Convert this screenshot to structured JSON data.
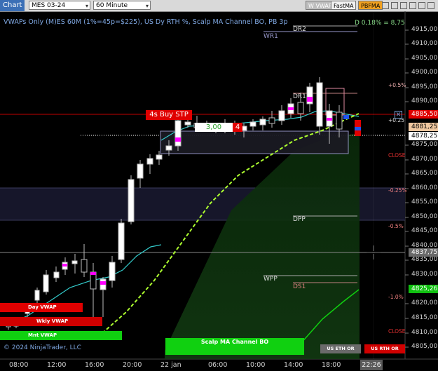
{
  "toolbar": {
    "chart_tab": "Chart",
    "instrument": "MES 03-24",
    "interval": "60 Minute",
    "buttons": [
      "W VWAP",
      "FastMA",
      "PBFMA"
    ]
  },
  "chart": {
    "title": "VWAPs Only (M)ES 60M  (1%=45p=$225), US Dy RTH %, Scalp MA Channel BO, PB 3p",
    "copyright": "© 2024 NinjaTrader, LLC",
    "top_right_readout": "D 0,18% = 8,75",
    "y_ticks": [
      "4915,00",
      "4910,00",
      "4905,00",
      "4900,00",
      "4895,00",
      "4890,00",
      "4875,00",
      "4870,00",
      "4865,00",
      "4860,00",
      "4855,00",
      "4850,00",
      "4845,00",
      "4840,00",
      "4835,00",
      "4830,00",
      "4820,00",
      "4815,00",
      "4810,00",
      "4805,00"
    ],
    "price_tags": [
      {
        "label": "4885,50",
        "bg": "#e00000",
        "fg": "#ffffff"
      },
      {
        "label": "4881,25",
        "bg": "#f0c8a0",
        "fg": "#000000"
      },
      {
        "label": "4878,25",
        "bg": "#ffffff",
        "fg": "#000000"
      },
      {
        "label": "4837,75",
        "bg": "#6a6a6a",
        "fg": "#ffffff"
      },
      {
        "label": "4825,26",
        "bg": "#10c010",
        "fg": "#ffffff"
      }
    ],
    "x_ticks": [
      "08:00",
      "12:00",
      "16:00",
      "20:00",
      "22 jan",
      "06:00",
      "10:00",
      "14:00",
      "18:00"
    ],
    "x_current": "22:26"
  },
  "levels": {
    "dr2": "DR2",
    "wr1": "WR1",
    "dr1": "DR1",
    "dpp": "DPP",
    "wpp": "WPP",
    "ds1": "DS1"
  },
  "pct_labels": {
    "p05": "+0.5%",
    "p025": "+0.25",
    "close1": "CLOSE",
    "m025": "-0.25%",
    "m05": "-0.5%",
    "m10": "-1.0%",
    "close2": "CLOSE"
  },
  "vwap_bars": {
    "day": "Day VWAP",
    "wkly": "Wkly VWAP",
    "mnt": "Mnt VWAP"
  },
  "order": {
    "buy_stop": "4s  Buy STP",
    "qty": "3,00",
    "qty_red": "4"
  },
  "scalp": "Scalp MA Channel BO",
  "session_buttons": {
    "eth": "US ETH OR",
    "rth": "US RTH OR"
  },
  "colors": {
    "up_candle": "#ffffff",
    "down_candle": "#000000",
    "magenta": "#ff00ff",
    "cyan_ma": "#33cccc",
    "lime_ma": "#adff2f",
    "green_ma": "#10d010",
    "red": "#e00000"
  }
}
